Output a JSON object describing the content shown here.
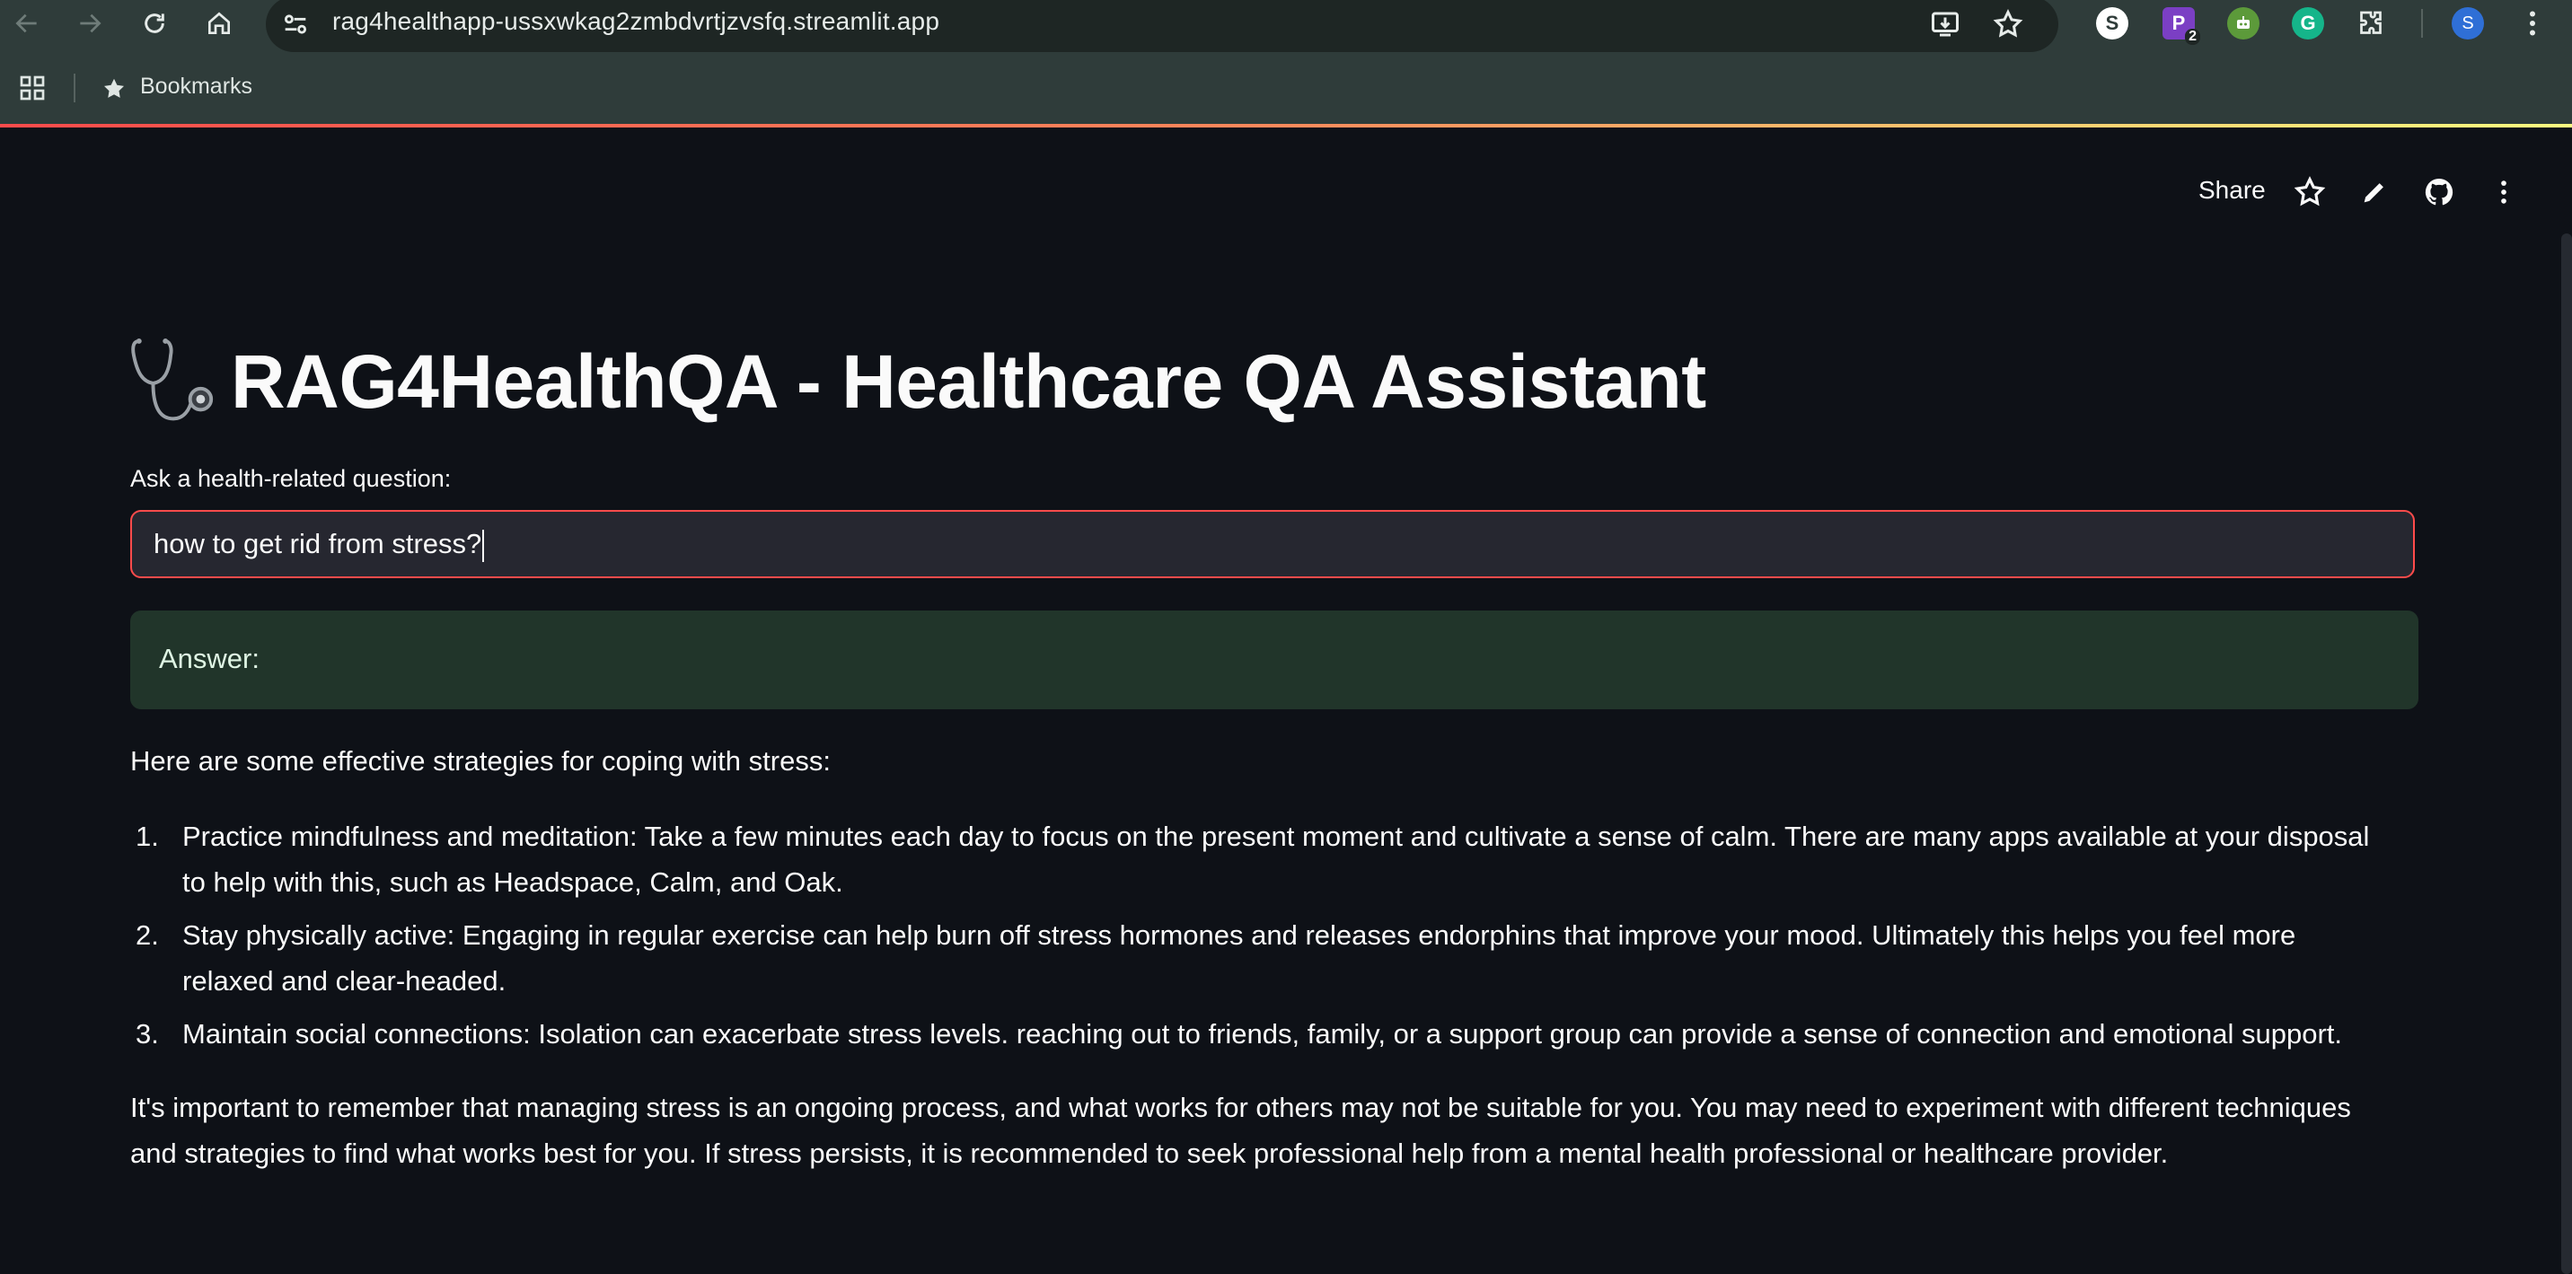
{
  "browser": {
    "url": "rag4healthapp-ussxwkag2zmbdvrtjzvsfq.streamlit.app",
    "bookmarks_label": "Bookmarks",
    "extensions": [
      {
        "name": "s-extension",
        "letter": "S",
        "color": "#ffffff",
        "text_color": "#2f3c3a"
      },
      {
        "name": "p-extension",
        "letter": "P",
        "badge": "2",
        "color": "#7b3fc4",
        "text_color": "#ffffff"
      },
      {
        "name": "robot-extension",
        "letter": "",
        "color": "#5c9a3a",
        "text_color": "#ffffff"
      },
      {
        "name": "grammarly-extension",
        "letter": "G",
        "color": "#15b58a",
        "text_color": "#ffffff"
      }
    ],
    "profile_initial": "S"
  },
  "app_header": {
    "share_label": "Share"
  },
  "page": {
    "title": "RAG4HealthQA - Healthcare QA Assistant",
    "title_icon": "stethoscope-icon",
    "input_label": "Ask a health-related question:",
    "input_value": "how to get rid from stress?",
    "answer_label": "Answer:",
    "intro": "Here are some effective strategies for coping with stress:",
    "strategies": [
      {
        "num": "1.",
        "text": "Practice mindfulness and meditation: Take a few minutes each day to focus on the present moment and cultivate a sense of calm. There are many apps available at your disposal to help with this, such as Headspace, Calm, and Oak."
      },
      {
        "num": "2.",
        "text": "Stay physically active: Engaging in regular exercise can help burn off stress hormones and releases endorphins that improve your mood. Ultimately this helps you feel more relaxed and clear-headed."
      },
      {
        "num": "3.",
        "text": "Maintain social connections: Isolation can exacerbate stress levels. reaching out to friends, family, or a support group can provide a sense of connection and emotional support."
      }
    ],
    "outro": "It's important to remember that managing stress is an ongoing process, and what works for others may not be suitable for you. You may need to experiment with different techniques and strategies to find what works best for you. If stress persists, it is recommended to seek professional help from a mental health professional or healthcare provider."
  },
  "colors": {
    "background": "#0e1117",
    "input_border": "#ff4b4b",
    "answer_bg": "#21352a"
  }
}
